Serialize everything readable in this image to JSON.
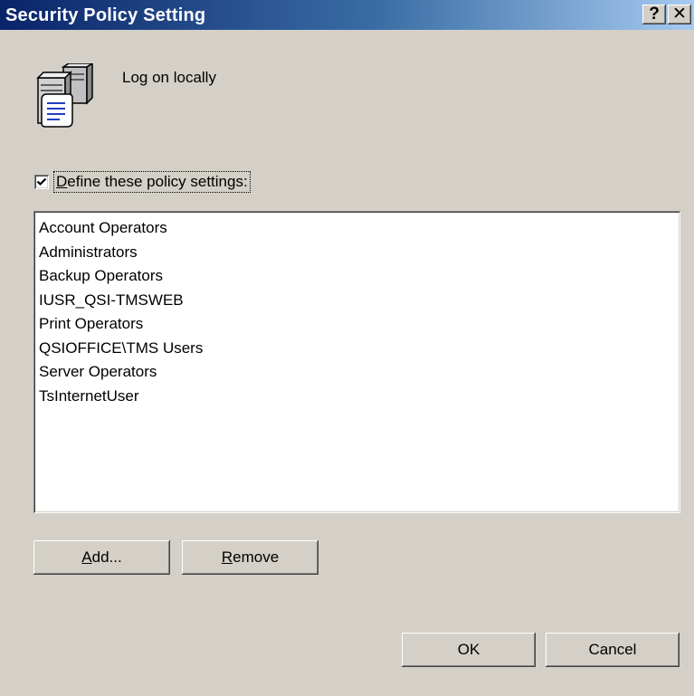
{
  "window": {
    "title": "Security Policy Setting",
    "help_glyph": "?",
    "close_glyph": "✕"
  },
  "policy": {
    "icon": "policy-server-icon",
    "name": "Log on locally"
  },
  "define_checkbox": {
    "checked": true,
    "label_mnemonic": "D",
    "label_rest": "efine these policy settings:"
  },
  "members": {
    "items": [
      "Account Operators",
      "Administrators",
      "Backup Operators",
      "IUSR_QSI-TMSWEB",
      "Print Operators",
      "QSIOFFICE\\TMS Users",
      "Server Operators",
      "TsInternetUser"
    ]
  },
  "buttons": {
    "add_mnemonic": "A",
    "add_rest": "dd...",
    "remove_mnemonic": "R",
    "remove_rest": "emove",
    "ok": "OK",
    "cancel": "Cancel"
  },
  "colors": {
    "dialog_face": "#d4d0c8",
    "title_start": "#0a246a",
    "title_end": "#a6caf0"
  }
}
